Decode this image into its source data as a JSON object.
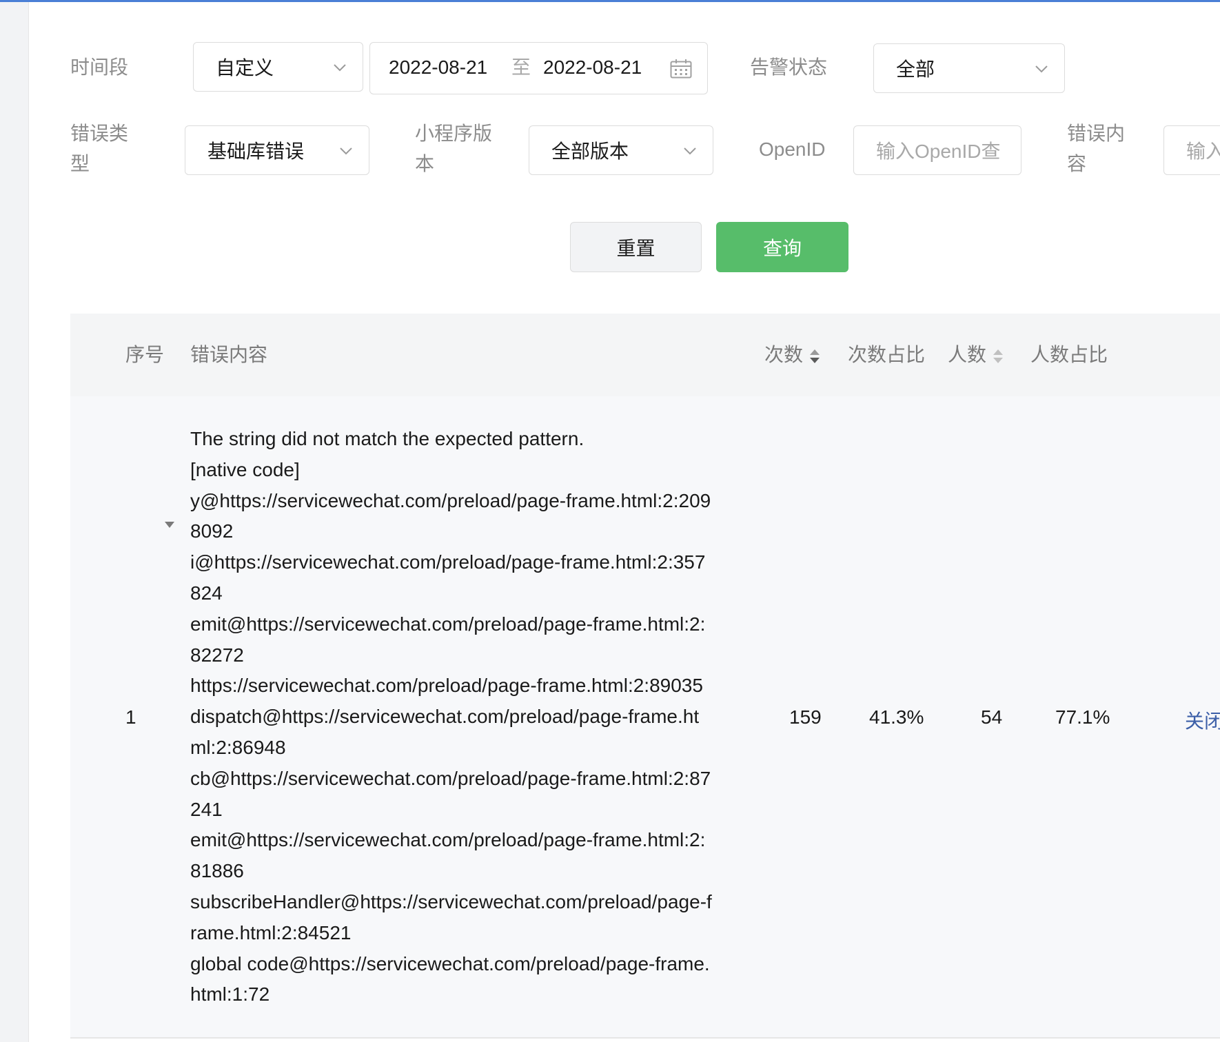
{
  "filters": {
    "time_period": {
      "label": "时间段",
      "value": "自定义"
    },
    "date_range": {
      "start": "2022-08-21",
      "separator": "至",
      "end": "2022-08-21"
    },
    "alert_status": {
      "label": "告警状态",
      "value": "全部"
    },
    "error_type": {
      "label_line1": "错误类",
      "label_line2": "型",
      "value": "基础库错误"
    },
    "mini_program_version": {
      "label_line1": "小程序版",
      "label_line2": "本",
      "value": "全部版本"
    },
    "openid": {
      "label": "OpenID",
      "placeholder": "输入OpenID查"
    },
    "error_content": {
      "label_line1": "错误内",
      "label_line2": "容",
      "placeholder": "输入"
    }
  },
  "buttons": {
    "reset": "重置",
    "query": "查询"
  },
  "table": {
    "headers": {
      "index": "序号",
      "error_content": "错误内容",
      "count": "次数",
      "count_ratio": "次数占比",
      "users": "人数",
      "users_ratio": "人数占比"
    },
    "rows": [
      {
        "index": "1",
        "error_lines": [
          "The string did not match the expected pattern.",
          "[native code]",
          "y@https://servicewechat.com/preload/page-frame.html:2:209",
          "8092",
          "i@https://servicewechat.com/preload/page-frame.html:2:357",
          "824",
          "emit@https://servicewechat.com/preload/page-frame.html:2:",
          "82272",
          "https://servicewechat.com/preload/page-frame.html:2:89035",
          "dispatch@https://servicewechat.com/preload/page-frame.ht",
          "ml:2:86948",
          "cb@https://servicewechat.com/preload/page-frame.html:2:87",
          "241",
          "emit@https://servicewechat.com/preload/page-frame.html:2:",
          "81886",
          "subscribeHandler@https://servicewechat.com/preload/page-f",
          "rame.html:2:84521",
          "global code@https://servicewechat.com/preload/page-frame.",
          "html:1:72"
        ],
        "count": "159",
        "count_ratio": "41.3%",
        "users": "54",
        "users_ratio": "77.1%",
        "action": "关闭"
      }
    ]
  },
  "colors": {
    "accent_line": "#4a7fd6",
    "primary_button": "#57bd6a",
    "link": "#3c5fa8"
  },
  "icons": {
    "dropdown": "chevron-down-icon",
    "calendar": "calendar-icon",
    "sort": "sort-icon",
    "expand": "caret-down-icon"
  }
}
